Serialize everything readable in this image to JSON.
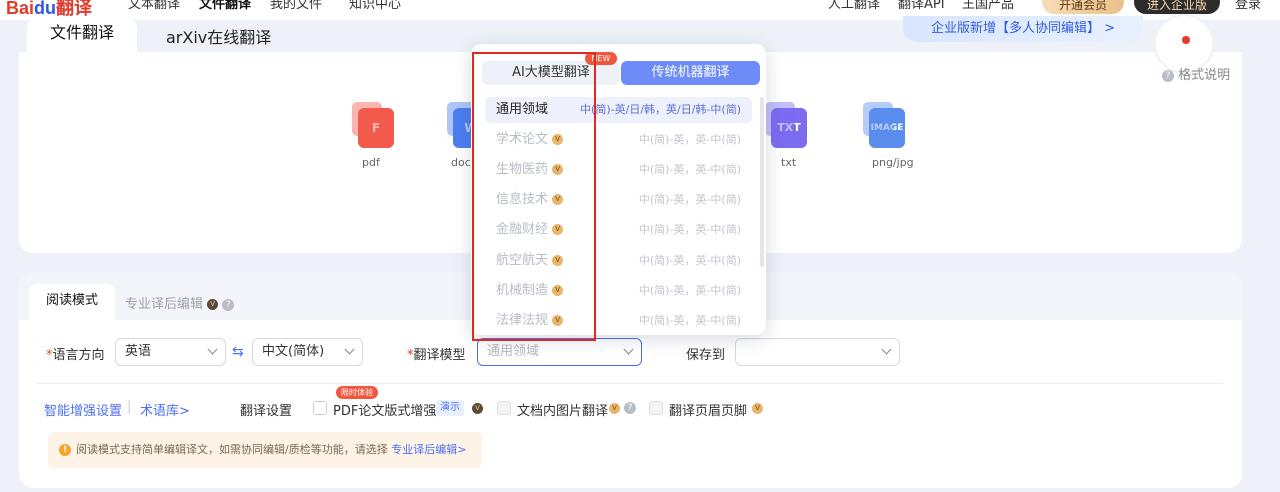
{
  "topnav": {
    "logo_a": "Bai",
    "logo_b": "du",
    "logo_c": "翻译",
    "items": [
      "文本翻译",
      "文件翻译",
      "我的文件",
      "知识中心"
    ],
    "right_items": [
      "人工翻译",
      "翻译API",
      "王国产品"
    ],
    "vip_button": "开通会员",
    "enterprise_button": "进入企业版",
    "login": "登录"
  },
  "upload": {
    "tabs": [
      "文件翻译",
      "arXiv在线翻译"
    ],
    "promo": "企业版新增【多人协同编辑】 >",
    "format_help": "格式说明",
    "files": [
      {
        "name": "pdf",
        "badge": "F",
        "color": "#f25a4b"
      },
      {
        "name": "doc",
        "badge": "W",
        "color": "#4d7ef0"
      },
      {
        "name": "txt",
        "badge": "TXT",
        "color": "#7b6cf0"
      },
      {
        "name": "png/jpg",
        "badge": "IMAGE",
        "color": "#5b8def"
      }
    ]
  },
  "settings": {
    "tab_read": "阅读模式",
    "tab_edit": "专业译后编辑",
    "lang_label": "语言方向",
    "source_lang": "英语",
    "target_lang": "中文(简体)",
    "model_label": "翻译模型",
    "model_placeholder": "通用领域",
    "save_label": "保存到",
    "smart_link": "智能增强设置",
    "term_link": "术语库>",
    "translate_settings": "翻译设置",
    "limited_tag": "限时体验",
    "pdf_enhance": "PDF论文版式增强",
    "demo": "演示",
    "img_translate": "文档内图片翻译",
    "header_footer": "翻译页眉页脚",
    "notice_text": "阅读模式支持简单编辑译文，如需协同编辑/质检等功能，请选择 ",
    "notice_link": "专业译后编辑>"
  },
  "popup": {
    "tab_ai": "AI大模型翻译",
    "new_badge": "NEW",
    "tab_mt": "传统机器翻译",
    "rows": [
      {
        "name": "通用领域",
        "dir": "中(简)-英/日/韩，英/日/韩-中(简)"
      },
      {
        "name": "学术论文",
        "dir": "中(简)-英，英-中(简)"
      },
      {
        "name": "生物医药",
        "dir": "中(简)-英，英-中(简)"
      },
      {
        "name": "信息技术",
        "dir": "中(简)-英，英-中(简)"
      },
      {
        "name": "金融财经",
        "dir": "中(简)-英，英-中(简)"
      },
      {
        "name": "航空航天",
        "dir": "中(简)-英，英-中(简)"
      },
      {
        "name": "机械制造",
        "dir": "中(简)-英，英-中(简)"
      },
      {
        "name": "法律法规",
        "dir": "中(简)-英，英-中(简)"
      }
    ]
  }
}
